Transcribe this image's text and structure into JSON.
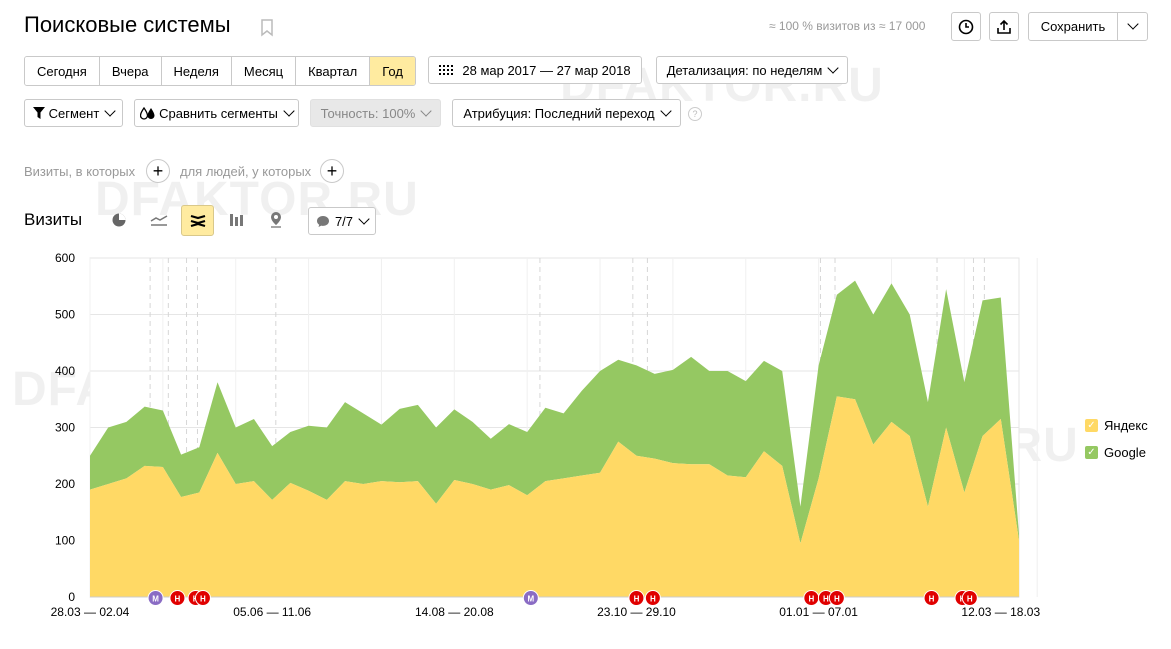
{
  "header": {
    "title": "Поисковые системы",
    "sampling_note": "≈ 100 % визитов из ≈ 17 000",
    "save_label": "Сохранить"
  },
  "period_tabs": [
    {
      "label": "Сегодня",
      "active": false
    },
    {
      "label": "Вчера",
      "active": false
    },
    {
      "label": "Неделя",
      "active": false
    },
    {
      "label": "Месяц",
      "active": false
    },
    {
      "label": "Квартал",
      "active": false
    },
    {
      "label": "Год",
      "active": true
    }
  ],
  "date_range": "28 мар 2017 — 27 мар 2018",
  "detail": "Детализация: по неделям",
  "filters": {
    "segment": "Сегмент",
    "compare": "Сравнить сегменты",
    "accuracy": "Точность: 100%",
    "attribution": "Атрибуция: Последний переход",
    "help": "?"
  },
  "segment_builder": {
    "visits_label": "Визиты, в которых",
    "people_label": "для людей, у которых"
  },
  "chart_header": {
    "title": "Визиты",
    "annotations_count": "7/7"
  },
  "watermark": "DFAKTOR.RU",
  "colors": {
    "yandex": "#ffd965",
    "google": "#95c862",
    "active_tab": "#ffeba0",
    "marker_red": "#e00000",
    "marker_purple": "#8a6cc4"
  },
  "chart_data": {
    "type": "area",
    "stacked": true,
    "x_tick_labels": [
      "28.03 — 02.04",
      "05.06 — 11.06",
      "14.08 — 20.08",
      "23.10 — 29.10",
      "01.01 — 07.01",
      "12.03 — 18.03"
    ],
    "ylim": [
      0,
      600
    ],
    "y_ticks": [
      0,
      100,
      200,
      300,
      400,
      500,
      600
    ],
    "grid": true,
    "legend_position": "right",
    "series": [
      {
        "name": "Яндекс",
        "values": [
          190,
          200,
          210,
          232,
          230,
          177,
          185,
          255,
          200,
          205,
          172,
          202,
          188,
          172,
          205,
          200,
          205,
          203,
          205,
          165,
          207,
          200,
          190,
          198,
          180,
          205,
          210,
          215,
          220,
          275,
          250,
          245,
          237,
          235,
          235,
          215,
          212,
          258,
          232,
          95,
          210,
          355,
          350,
          270,
          310,
          285,
          160,
          300,
          185,
          285,
          315,
          100
        ]
      },
      {
        "name": "Google",
        "values": [
          60,
          100,
          100,
          105,
          100,
          75,
          80,
          125,
          100,
          110,
          95,
          90,
          115,
          128,
          140,
          125,
          100,
          130,
          135,
          135,
          125,
          110,
          90,
          108,
          112,
          130,
          115,
          150,
          180,
          145,
          160,
          150,
          165,
          190,
          165,
          185,
          170,
          160,
          168,
          65,
          200,
          180,
          210,
          230,
          245,
          215,
          185,
          245,
          195,
          240,
          215,
          10
        ]
      }
    ],
    "annotations": [
      {
        "label": "М",
        "type": "purple"
      },
      {
        "label": "Н",
        "type": "red"
      },
      {
        "label": "Н",
        "type": "red"
      },
      {
        "label": "Н",
        "type": "red"
      },
      {
        "label": "М",
        "type": "purple"
      },
      {
        "label": "Н",
        "type": "red"
      },
      {
        "label": "Н",
        "type": "red"
      },
      {
        "label": "Н",
        "type": "red"
      },
      {
        "label": "Н",
        "type": "red"
      },
      {
        "label": "Н",
        "type": "red"
      }
    ]
  }
}
